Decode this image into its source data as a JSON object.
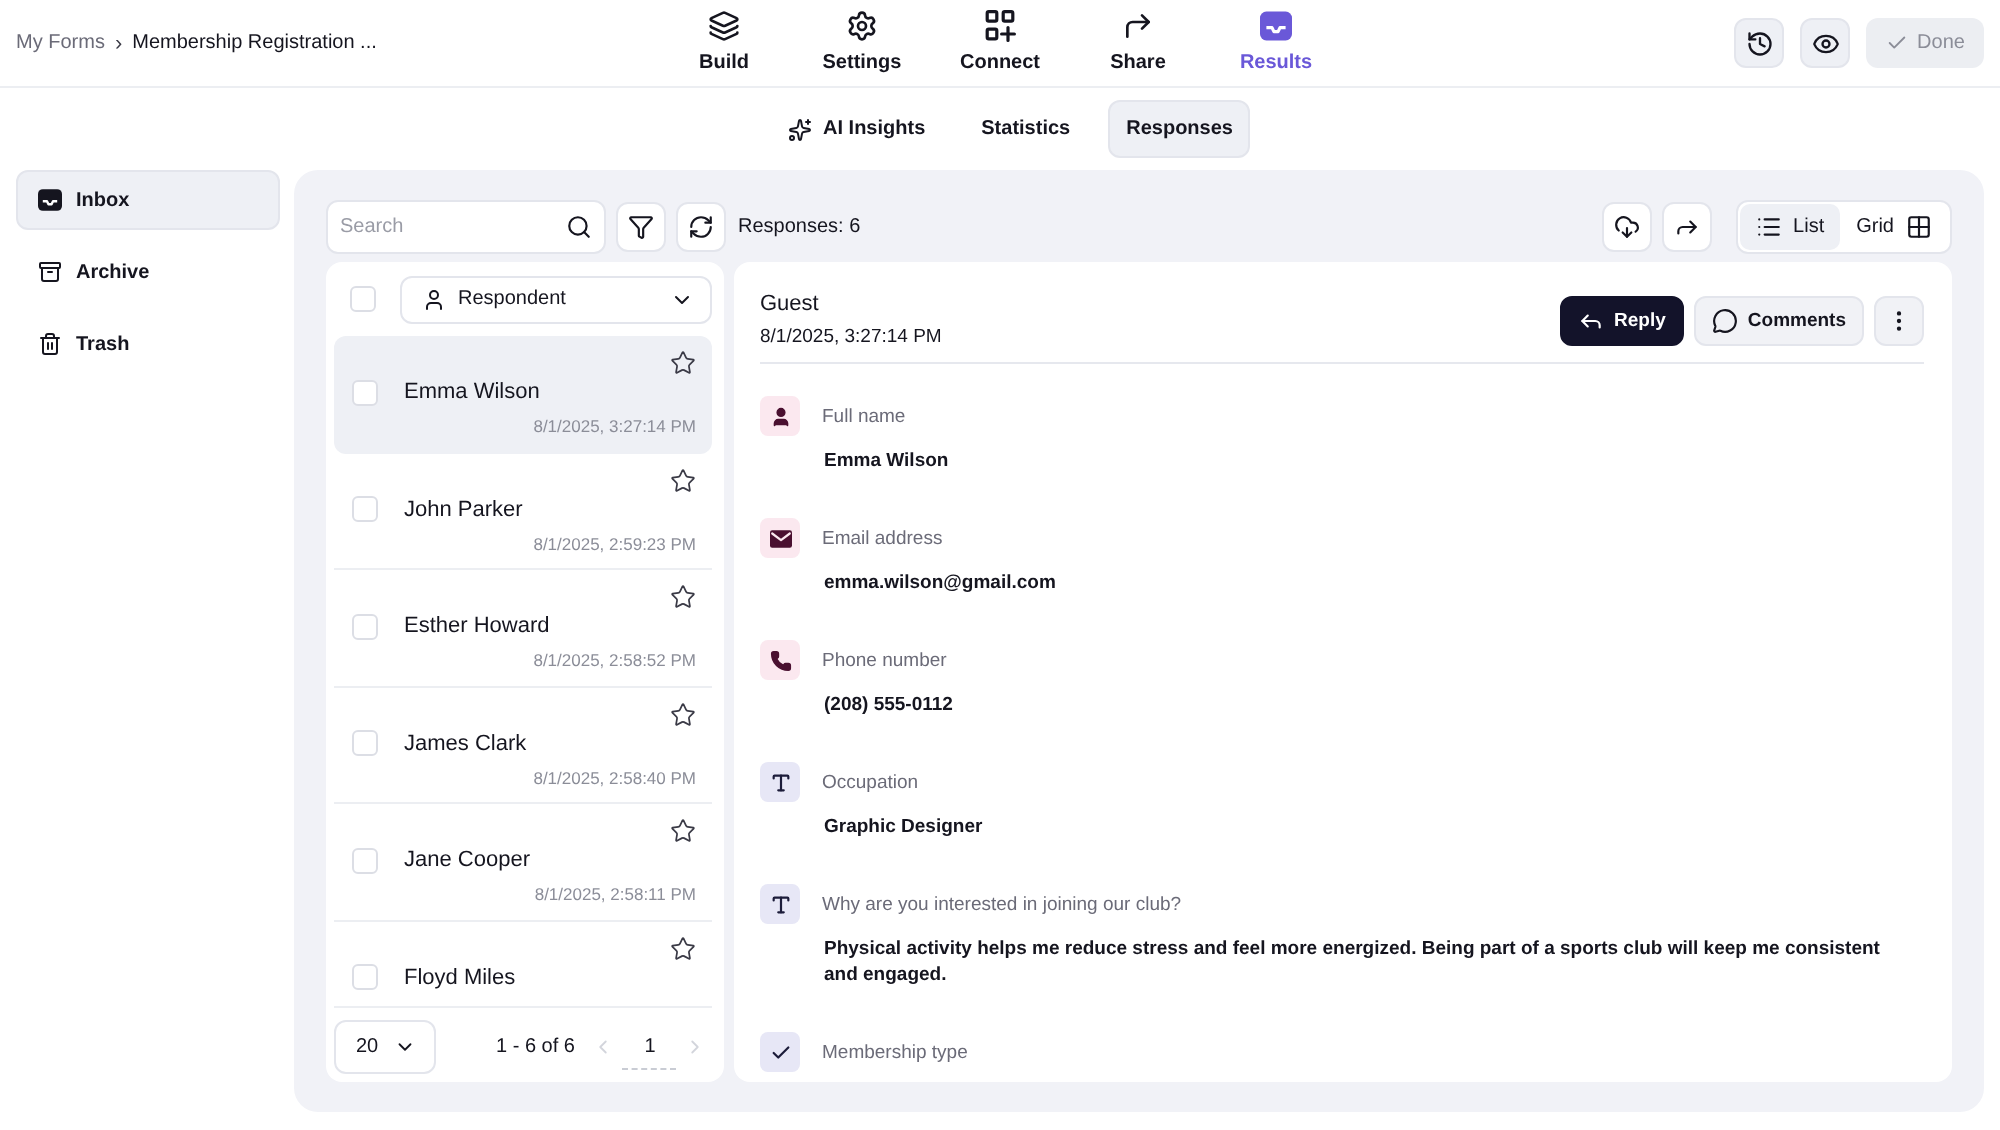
{
  "header": {
    "breadcrumb": {
      "parent": "My Forms",
      "separator": "›",
      "current": "Membership Registration ..."
    },
    "nav": [
      {
        "kind": "build",
        "label": "Build",
        "selected": false
      },
      {
        "kind": "settings",
        "label": "Settings",
        "selected": false
      },
      {
        "kind": "connect",
        "label": "Connect",
        "selected": false
      },
      {
        "kind": "share",
        "label": "Share",
        "selected": false
      },
      {
        "kind": "results",
        "label": "Results",
        "selected": true
      }
    ],
    "actions": [
      {
        "kind": "history"
      },
      {
        "kind": "preview"
      }
    ],
    "done": {
      "label": "Done",
      "disabled": true
    }
  },
  "result_tabs": [
    {
      "kind": "ai",
      "label": "AI Insights",
      "selected": false
    },
    {
      "kind": "plain",
      "label": "Statistics",
      "selected": false
    },
    {
      "kind": "plain",
      "label": "Responses",
      "selected": true
    }
  ],
  "sidebar": {
    "items": [
      {
        "kind": "inbox",
        "label": "Inbox",
        "selected": true
      },
      {
        "kind": "archive",
        "label": "Archive",
        "selected": false
      },
      {
        "kind": "trash",
        "label": "Trash",
        "selected": false
      }
    ]
  },
  "toolbar": {
    "search": {
      "placeholder": "Search"
    },
    "tools": [
      {
        "kind": "filter"
      },
      {
        "kind": "refresh"
      }
    ],
    "count": "Responses: 6",
    "exports": [
      {
        "kind": "download"
      },
      {
        "kind": "share"
      }
    ],
    "views": [
      {
        "kind": "list",
        "label": "List",
        "selected": true
      },
      {
        "kind": "grid",
        "label": "Grid",
        "selected": false
      }
    ]
  },
  "list": {
    "all_checked": false,
    "filter": {
      "label": "Respondent"
    },
    "rows": [
      {
        "name": "Emma Wilson",
        "time": "8/1/2025, 3:27:14 PM",
        "selected": true,
        "checked": false,
        "starred": false
      },
      {
        "name": "John Parker",
        "time": "8/1/2025, 2:59:23 PM",
        "selected": false,
        "checked": false,
        "starred": false
      },
      {
        "name": "Esther Howard",
        "time": "8/1/2025, 2:58:52 PM",
        "selected": false,
        "checked": false,
        "starred": false
      },
      {
        "name": "James Clark",
        "time": "8/1/2025, 2:58:40 PM",
        "selected": false,
        "checked": false,
        "starred": false
      },
      {
        "name": "Jane Cooper",
        "time": "8/1/2025, 2:58:11 PM",
        "selected": false,
        "checked": false,
        "starred": false
      },
      {
        "name": "Floyd Miles",
        "selected": false,
        "checked": false,
        "starred": false
      }
    ],
    "pagination": {
      "page_size": "20",
      "range": "1 - 6 of 6",
      "page": "1",
      "prev_disabled": true,
      "next_disabled": true
    }
  },
  "detail": {
    "respondent": "Guest",
    "submitted": "8/1/2025, 3:27:14 PM",
    "actions": [
      {
        "kind": "reply",
        "label": "Reply"
      },
      {
        "kind": "comments",
        "label": "Comments"
      },
      {
        "kind": "more"
      }
    ],
    "fields": [
      {
        "kind": "name",
        "label": "Full name",
        "value": "Emma Wilson"
      },
      {
        "kind": "email",
        "label": "Email address",
        "value": "emma.wilson@gmail.com"
      },
      {
        "kind": "phone",
        "label": "Phone number",
        "value": "(208) 555-0112"
      },
      {
        "kind": "text",
        "label": "Occupation",
        "value": "Graphic Designer"
      },
      {
        "kind": "text",
        "label": "Why are you interested in joining our club?",
        "value": "Physical activity helps me reduce stress and feel more energized. Being part of a sports club will keep me consistent and engaged."
      },
      {
        "kind": "choice",
        "label": "Membership type"
      }
    ]
  }
}
